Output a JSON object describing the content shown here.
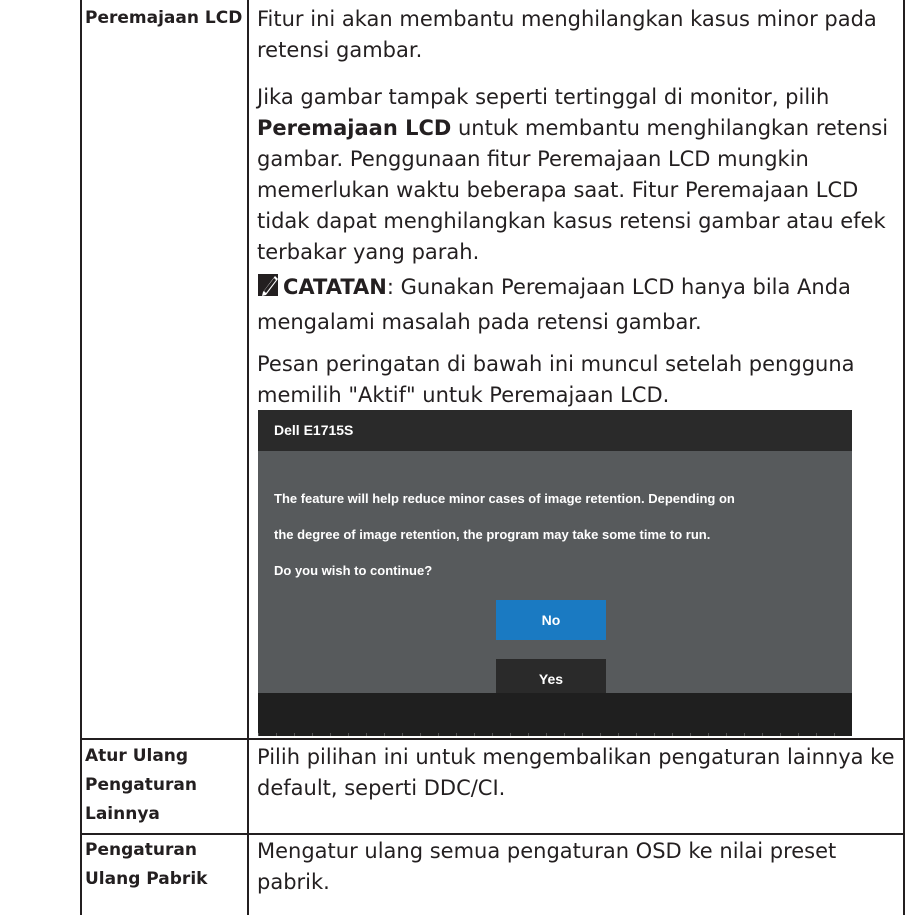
{
  "rows": [
    {
      "label": "Peremajaan LCD",
      "intro": "Fitur ini akan membantu menghilangkan kasus minor pada retensi gambar.",
      "p2_pre": "Jika gambar tampak seperti tertinggal di monitor, pilih",
      "p2_bold": "Peremajaan LCD",
      "p2_post": "untuk membantu menghilangkan retensi gambar. Penggunaan fitur Peremajaan LCD mungkin memerlukan waktu beberapa saat. Fitur Peremajaan LCD tidak dapat menghilangkan kasus retensi gambar atau efek terbakar yang parah.",
      "note_label": "CATATAN",
      "note_text": ": Gunakan Peremajaan LCD hanya bila Anda mengalami masalah pada retensi gambar.",
      "warning_text": "Pesan peringatan di bawah ini muncul setelah pengguna memilih \"Aktif\" untuk Peremajaan LCD."
    },
    {
      "label_line1": "Atur Ulang",
      "label_line2": "Pengaturan",
      "label_line3": "Lainnya",
      "desc": "Pilih pilihan ini untuk mengembalikan pengaturan lainnya ke default, seperti DDC/CI."
    },
    {
      "label_line1": "Pengaturan",
      "label_line2": "Ulang Pabrik",
      "desc": "Mengatur ulang semua pengaturan OSD ke nilai preset pabrik."
    }
  ],
  "osd": {
    "title": "Dell E1715S",
    "line1": "The feature will help reduce minor cases of image retention. Depending on",
    "line2": "the degree of image retention, the program may take some time to run.",
    "line3": "Do you wish to continue?",
    "btn_no": "No",
    "btn_yes": "Yes",
    "btn_no_color": "#1a7ac2",
    "btn_yes_color": "#2a2a2a"
  },
  "icons": {
    "note_icon": "pencil-note-icon"
  }
}
